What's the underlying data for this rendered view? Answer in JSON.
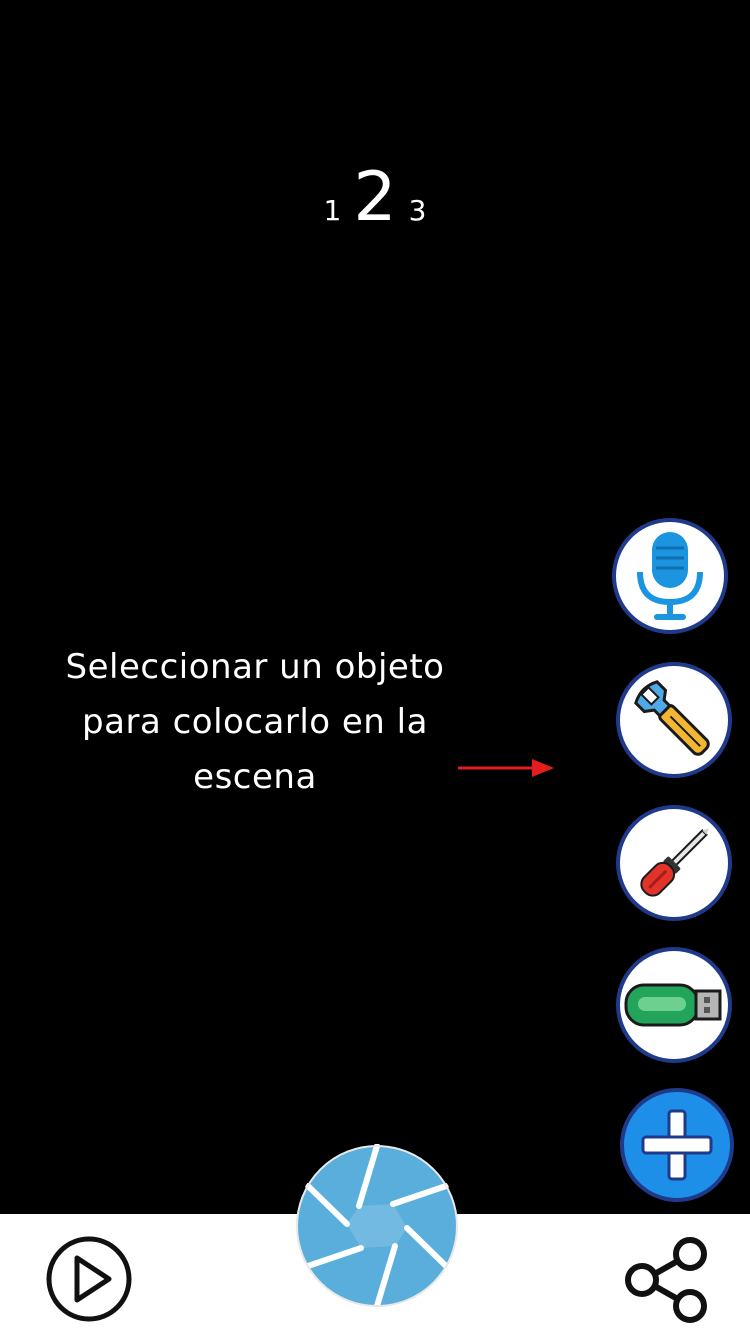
{
  "steps": {
    "prev": "1",
    "current": "2",
    "next": "3"
  },
  "hint": {
    "text": "Seleccionar un objeto para colocarlo en la escena",
    "arrow_color": "#e11d1d"
  },
  "tools": [
    {
      "name": "microphone",
      "icon": "microphone-icon"
    },
    {
      "name": "wrench",
      "icon": "wrench-icon"
    },
    {
      "name": "screwdriver",
      "icon": "screwdriver-icon"
    },
    {
      "name": "usb-drive",
      "icon": "usb-drive-icon"
    },
    {
      "name": "add",
      "icon": "plus-icon"
    }
  ],
  "bottom_bar": {
    "play_icon": "play-circle-icon",
    "shutter_icon": "camera-aperture-icon",
    "share_icon": "share-icon"
  },
  "colors": {
    "background": "#000000",
    "tool_border": "#1f3a8a",
    "add_fill": "#1e8fe8",
    "aperture_blue": "#5aaedc"
  }
}
